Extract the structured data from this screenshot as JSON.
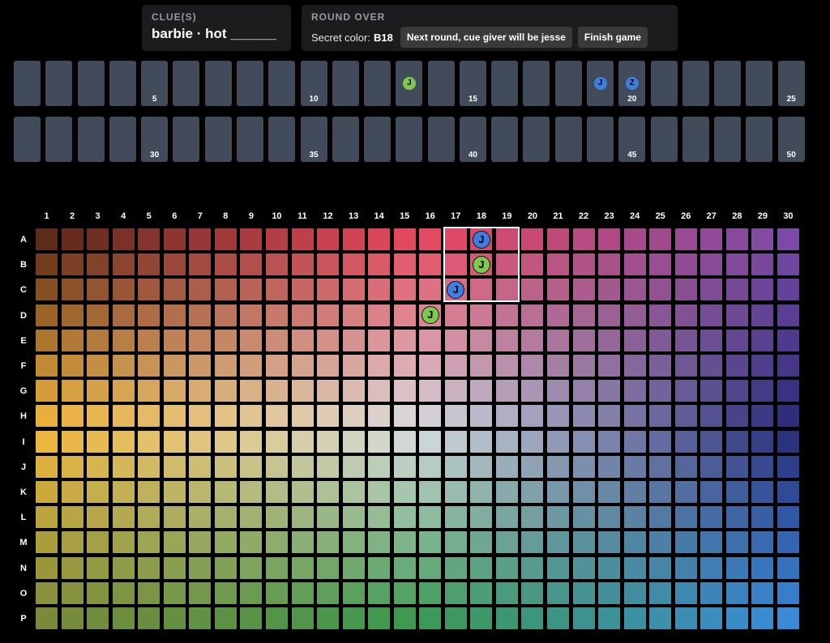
{
  "clue_panel": {
    "heading": "CLUE(S)",
    "clue": "barbie · hot ______"
  },
  "round_panel": {
    "heading": "ROUND OVER",
    "secret_label": "Secret color:",
    "secret_value": "B18",
    "next_round_button": "Next round, cue giver will be jesse",
    "finish_button": "Finish game"
  },
  "score_track": {
    "slot_count": 50,
    "labels": {
      "5": "5",
      "10": "10",
      "15": "15",
      "20": "20",
      "25": "25",
      "30": "30",
      "35": "35",
      "40": "40",
      "45": "45",
      "50": "50"
    },
    "tokens": [
      {
        "slot": 13,
        "letter": "J",
        "color": "#7cc94e"
      },
      {
        "slot": 19,
        "letter": "J",
        "color": "#3d7fe0"
      },
      {
        "slot": 20,
        "letter": "Z",
        "color": "#3d7fe0"
      }
    ]
  },
  "board": {
    "columns": [
      "1",
      "2",
      "3",
      "4",
      "5",
      "6",
      "7",
      "8",
      "9",
      "10",
      "11",
      "12",
      "13",
      "14",
      "15",
      "16",
      "17",
      "18",
      "19",
      "20",
      "21",
      "22",
      "23",
      "24",
      "25",
      "26",
      "27",
      "28",
      "29",
      "30"
    ],
    "rows": [
      "A",
      "B",
      "C",
      "D",
      "E",
      "F",
      "G",
      "H",
      "I",
      "J",
      "K",
      "L",
      "M",
      "N",
      "O",
      "P"
    ],
    "corner_colors": {
      "top_left": "#5e2a1a",
      "top_mid": "#e84a5f",
      "top_right": "#7a4aa6",
      "mid_left": "#f3b93e",
      "center": "#d9dfe3",
      "mid_right": "#2a2c78",
      "bottom_left": "#7a8a3a",
      "bottom_mid": "#3d9a52",
      "bottom_right": "#3a8ad8"
    },
    "secret_cell": "B18",
    "highlight": {
      "from": "A17",
      "to": "C19"
    },
    "tokens": [
      {
        "cell": "A18",
        "letter": "J",
        "color": "#3d7fe0"
      },
      {
        "cell": "B18",
        "letter": "J",
        "color": "#7cc94e"
      },
      {
        "cell": "C17",
        "letter": "J",
        "color": "#3d7fe0"
      },
      {
        "cell": "D16",
        "letter": "J",
        "color": "#7cc94e"
      }
    ]
  }
}
